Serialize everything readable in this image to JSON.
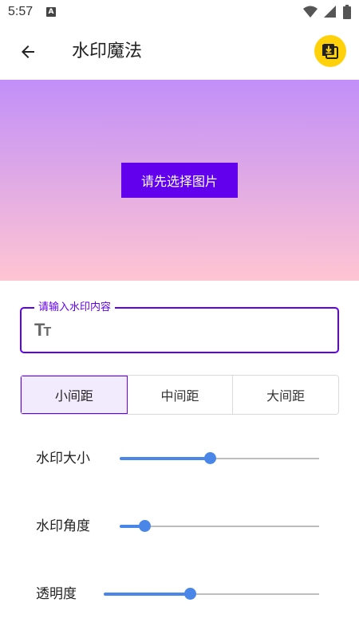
{
  "status_bar": {
    "time": "5:57",
    "notification_badge": "A",
    "icons": [
      "wifi-icon",
      "signal-icon",
      "battery-icon"
    ]
  },
  "app_bar": {
    "title": "水印魔法",
    "back_icon": "arrow-left-icon",
    "download_icon": "download-icon",
    "download_color": "#FFD10A"
  },
  "preview": {
    "select_button_label": "请先选择图片",
    "gradient_top": "#C18FF8",
    "gradient_bottom": "#FFC5D2",
    "button_color": "#6200EE"
  },
  "watermark_input": {
    "label": "请输入水印内容",
    "value": "",
    "icon": "text-size-icon"
  },
  "spacing": {
    "options": [
      "小间距",
      "中间距",
      "大间距"
    ],
    "selected": 0
  },
  "sliders": [
    {
      "label": "水印大小",
      "value": 0.45
    },
    {
      "label": "水印角度",
      "value": 0.125
    },
    {
      "label": "透明度",
      "value": 0.4
    }
  ],
  "colors": {
    "accent": "#6200EE",
    "slider": "#4A86E8"
  }
}
